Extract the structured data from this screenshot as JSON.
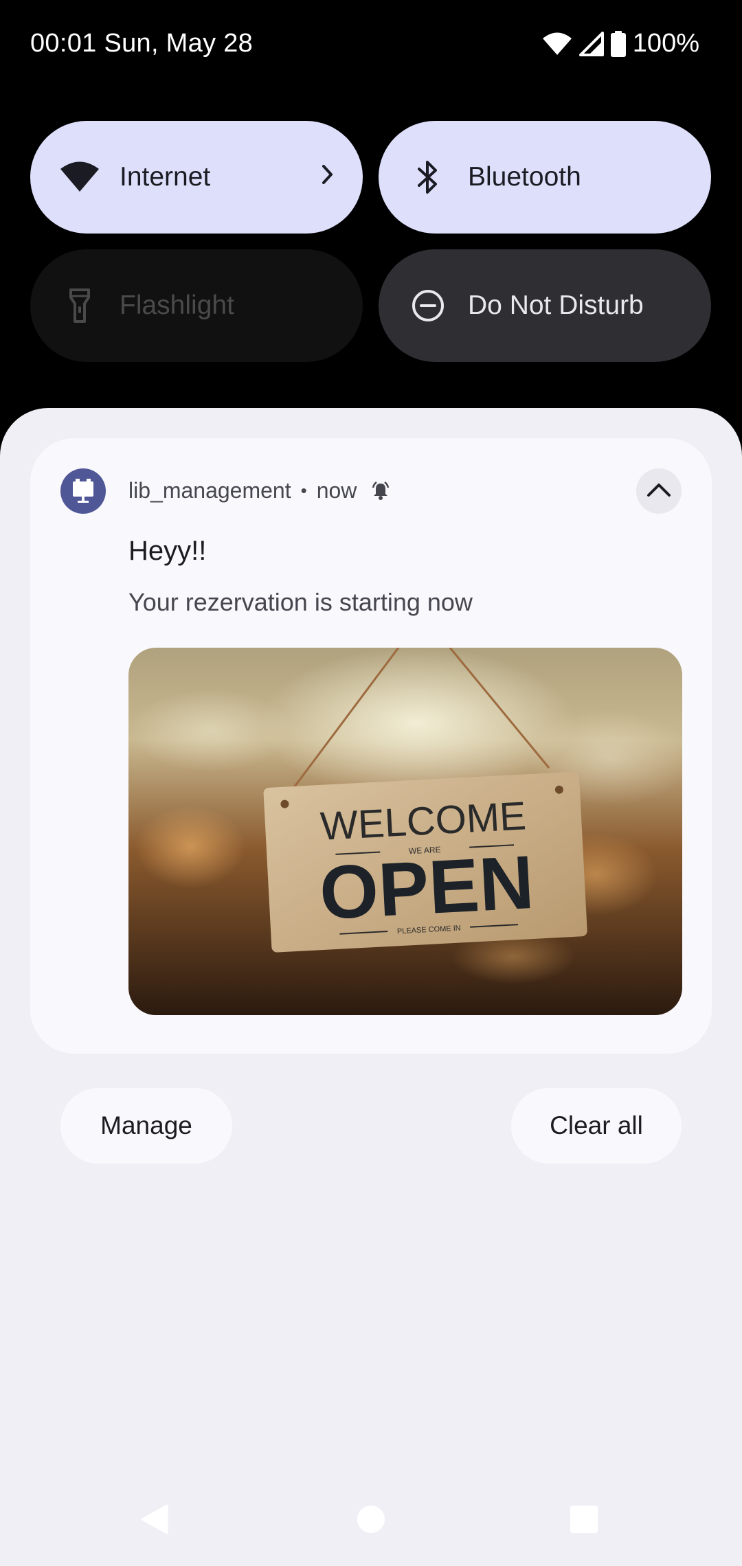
{
  "status_bar": {
    "time_date": "00:01 Sun, May 28",
    "battery": "100%",
    "icons": [
      "wifi-icon",
      "cellular-signal-icon",
      "battery-icon"
    ]
  },
  "quick_settings": {
    "tiles": [
      {
        "label": "Internet",
        "icon": "wifi-icon",
        "state": "on",
        "has_chevron": true
      },
      {
        "label": "Bluetooth",
        "icon": "bluetooth-icon",
        "state": "on"
      },
      {
        "label": "Flashlight",
        "icon": "flashlight-icon",
        "state": "unavailable"
      },
      {
        "label": "Do Not Disturb",
        "icon": "do-not-disturb-icon",
        "state": "off"
      }
    ]
  },
  "notification": {
    "app_name": "lib_management",
    "separator": "•",
    "time": "now",
    "title": "Heyy!!",
    "text": "Your rezervation is starting now",
    "image": {
      "description_icon": "welcome-open-sign-image",
      "sign_top": "WELCOME",
      "sign_small": "WE ARE",
      "sign_main": "OPEN",
      "sign_bottom": "PLEASE COME IN"
    }
  },
  "actions": {
    "manage_label": "Manage",
    "clear_all_label": "Clear all"
  },
  "nav_bar": {
    "items": [
      "back-icon",
      "home-icon",
      "recents-icon"
    ]
  },
  "colors": {
    "tile_on": "#dee0fb",
    "tile_dark": "#2e2e33",
    "shade_bg": "#f0eff5",
    "card_bg": "#f9f8fd",
    "app_icon_bg": "#4f5796"
  }
}
